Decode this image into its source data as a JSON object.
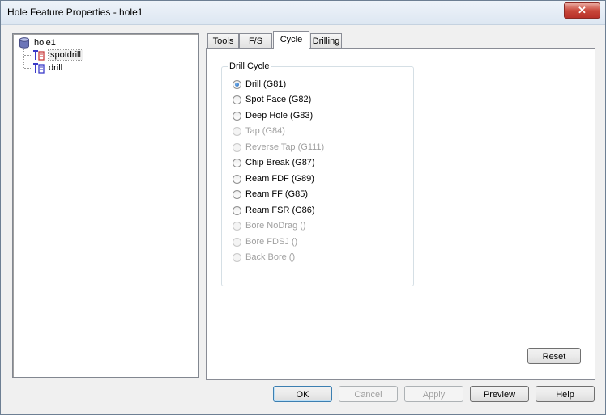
{
  "window": {
    "title": "Hole Feature Properties - hole1",
    "close_glyph": "✕"
  },
  "tree": {
    "root": {
      "label": "hole1",
      "icon": "database-icon"
    },
    "children": [
      {
        "label": "spotdrill",
        "icon": "tool-operation-icon",
        "selected": true
      },
      {
        "label": "drill",
        "icon": "tool-operation-icon",
        "selected": false
      }
    ]
  },
  "tabs": [
    {
      "label": "Tools",
      "active": false
    },
    {
      "label": "F/S",
      "active": false
    },
    {
      "label": "Cycle",
      "active": true
    },
    {
      "label": "Drilling",
      "active": false
    }
  ],
  "drill_cycle": {
    "group_title": "Drill Cycle",
    "options": [
      {
        "label": "Drill (G81)",
        "checked": true,
        "enabled": true
      },
      {
        "label": "Spot Face (G82)",
        "checked": false,
        "enabled": true
      },
      {
        "label": "Deep Hole (G83)",
        "checked": false,
        "enabled": true
      },
      {
        "label": "Tap  (G84)",
        "checked": false,
        "enabled": false
      },
      {
        "label": "Reverse Tap (G111)",
        "checked": false,
        "enabled": false
      },
      {
        "label": "Chip Break (G87)",
        "checked": false,
        "enabled": true
      },
      {
        "label": "Ream FDF (G89)",
        "checked": false,
        "enabled": true
      },
      {
        "label": "Ream FF (G85)",
        "checked": false,
        "enabled": true
      },
      {
        "label": "Ream FSR (G86)",
        "checked": false,
        "enabled": true
      },
      {
        "label": "Bore NoDrag ()",
        "checked": false,
        "enabled": false
      },
      {
        "label": "Bore FDSJ ()",
        "checked": false,
        "enabled": false
      },
      {
        "label": "Back Bore ()",
        "checked": false,
        "enabled": false
      }
    ]
  },
  "buttons": {
    "reset": "Reset",
    "ok": "OK",
    "cancel": "Cancel",
    "apply": "Apply",
    "preview": "Preview",
    "help": "Help"
  },
  "colors": {
    "accent": "#3c7fb1",
    "disabled_text": "#a0a0a0",
    "close_button": "#c9483b"
  }
}
